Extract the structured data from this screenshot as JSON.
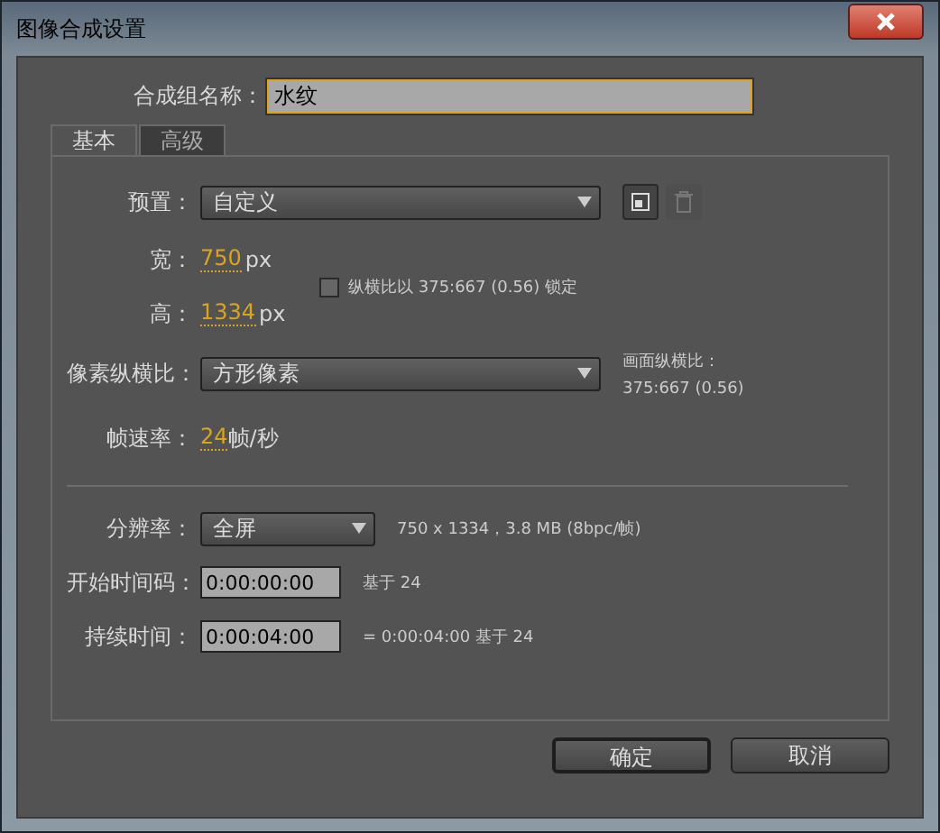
{
  "window": {
    "title": "图像合成设置"
  },
  "composition_name": {
    "label": "合成组名称：",
    "value": "水纹"
  },
  "tabs": [
    {
      "label": "基本",
      "selected": true
    },
    {
      "label": "高级",
      "selected": false
    }
  ],
  "preset": {
    "label": "预置：",
    "value": "自定义",
    "delete_disabled": true
  },
  "width": {
    "label": "宽：",
    "value": "750",
    "unit": "px"
  },
  "height": {
    "label": "高：",
    "value": "1334",
    "unit": "px"
  },
  "lock_aspect": {
    "label": "纵横比以 375:667 (0.56) 锁定",
    "checked": false
  },
  "pixel_aspect": {
    "label": "像素纵横比：",
    "value": "方形像素"
  },
  "frame_aspect": {
    "label": "画面纵横比：",
    "value": "375:667 (0.56)"
  },
  "frame_rate": {
    "label": "帧速率：",
    "value": "24",
    "unit": "帧/秒"
  },
  "resolution": {
    "label": "分辨率：",
    "value": "全屏",
    "info": "750 x 1334，3.8 MB (8bpc/帧)"
  },
  "start_timecode": {
    "label": "开始时间码：",
    "value": "0:00:00:00",
    "note": "基于 24"
  },
  "duration": {
    "label": "持续时间：",
    "value": "0:00:04:00",
    "note": "= 0:00:04:00  基于 24"
  },
  "buttons": [
    "确定",
    "取消"
  ]
}
